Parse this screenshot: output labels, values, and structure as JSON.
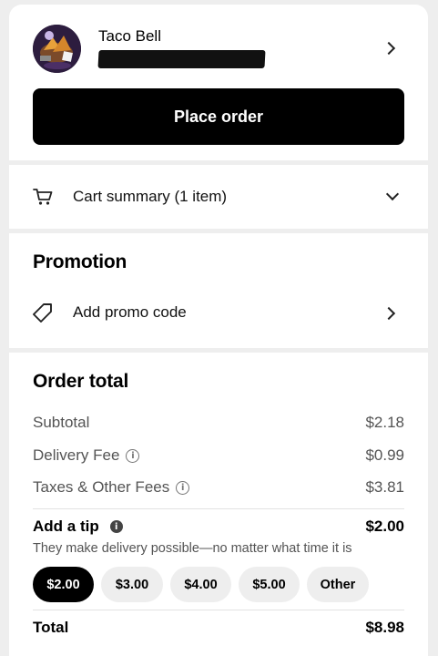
{
  "store": {
    "name": "Taco Bell"
  },
  "actions": {
    "place_order": "Place order"
  },
  "cart": {
    "summary_label": "Cart summary (1 item)"
  },
  "promotion": {
    "title": "Promotion",
    "add_promo_label": "Add promo code"
  },
  "order_total": {
    "title": "Order total",
    "rows": [
      {
        "label": "Subtotal",
        "value": "$2.18"
      },
      {
        "label": "Delivery Fee",
        "value": "$0.99"
      },
      {
        "label": "Taxes & Other Fees",
        "value": "$3.81"
      }
    ],
    "tip": {
      "label": "Add a tip",
      "value": "$2.00",
      "subtitle": "They make delivery possible—no matter what time it is",
      "options": [
        "$2.00",
        "$3.00",
        "$4.00",
        "$5.00",
        "Other"
      ],
      "selected_option": "$2.00"
    },
    "total": {
      "label": "Total",
      "value": "$8.98"
    }
  },
  "icons": {
    "store_chevron": "chevron-right-icon",
    "cart": "cart-icon",
    "cart_chevron": "chevron-down-icon",
    "promo": "tag-icon",
    "promo_chevron": "chevron-right-icon",
    "info": "info-icon"
  },
  "colors": {
    "primary_button": "#000000",
    "selected_tip": "#000000",
    "unselected_tip": "#eeeeee",
    "secondary_text": "#545454",
    "background": "#eeeeee"
  }
}
